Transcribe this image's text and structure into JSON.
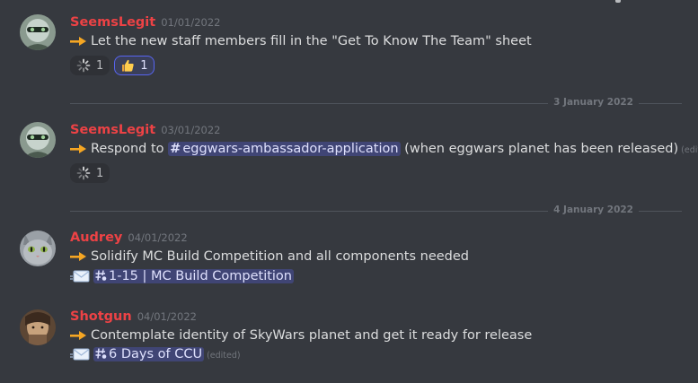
{
  "messages": [
    {
      "author": "SeemsLegit",
      "timestamp": "01/01/2022",
      "text": "Let the new staff members fill in the \"Get To Know The Team\" sheet",
      "reactions": [
        {
          "emoji": "loading-icon",
          "count": "1",
          "me": false
        },
        {
          "emoji": "thumbs-up",
          "count": "1",
          "me": true
        }
      ]
    },
    {
      "author": "SeemsLegit",
      "timestamp": "03/01/2022",
      "text_before": "Respond to",
      "channel": "eggwars-ambassador-application",
      "text_after": "(when eggwars planet has been released)",
      "edited": "(edited)",
      "reactions": [
        {
          "emoji": "loading-icon",
          "count": "1",
          "me": false
        }
      ]
    },
    {
      "author": "Audrey",
      "timestamp": "04/01/2022",
      "text": "Solidify MC Build Competition and all components needed",
      "channel": "1-15 | MC Build Competition"
    },
    {
      "author": "Shotgun",
      "timestamp": "04/01/2022",
      "text": "Contemplate identity of SkyWars planet and get it ready for release",
      "channel": "6 Days of CCU",
      "edited": "(edited)"
    }
  ],
  "dividers": [
    "3 January 2022",
    "4 January 2022"
  ],
  "colors": {
    "background": "#36393f",
    "username": "#ed4245",
    "mention_bg": "#4a5186",
    "arrow": "#f5a623"
  }
}
